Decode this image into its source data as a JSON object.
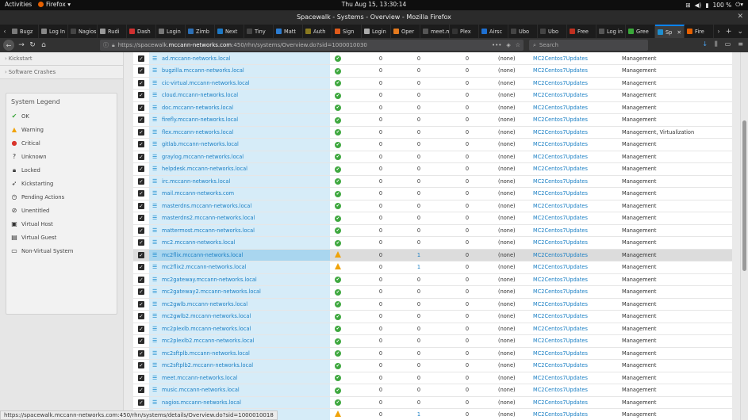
{
  "topbar": {
    "activities": "Activities",
    "app": "Firefox ▾",
    "clock": "Thu Aug 15, 13:30:14",
    "battery": "100 %"
  },
  "window": {
    "title": "Spacewalk - Systems - Overview - Mozilla Firefox"
  },
  "tabs": [
    {
      "label": "Bugz",
      "color": "#7a7a7a"
    },
    {
      "label": "Log In",
      "color": "#888888"
    },
    {
      "label": "Nagios",
      "color": "#444444"
    },
    {
      "label": "Rudi",
      "color": "#999999"
    },
    {
      "label": "Dash",
      "color": "#d03030"
    },
    {
      "label": "Login",
      "color": "#777777"
    },
    {
      "label": "Zimb",
      "color": "#2c6fb5"
    },
    {
      "label": "Next",
      "color": "#1d78c4"
    },
    {
      "label": "Tiny",
      "color": "#444444"
    },
    {
      "label": "Matt",
      "color": "#2c7cd1"
    },
    {
      "label": "Auth",
      "color": "#8a7a20"
    },
    {
      "label": "Sign",
      "color": "#e05a1a"
    },
    {
      "label": "Login",
      "color": "#aaaaaa"
    },
    {
      "label": "Oper",
      "color": "#e57a1e"
    },
    {
      "label": "meet.m",
      "color": "#555555"
    },
    {
      "label": "Plex",
      "color": "#333333"
    },
    {
      "label": "Airsc",
      "color": "#1e6fd0"
    },
    {
      "label": "Ubo",
      "color": "#444444"
    },
    {
      "label": "Ubo",
      "color": "#444444"
    },
    {
      "label": "Free",
      "color": "#c03020"
    },
    {
      "label": "Log in",
      "color": "#555555"
    },
    {
      "label": "Gree",
      "color": "#3aa83a"
    },
    {
      "label": "Sp",
      "color": "#1e8fd0"
    },
    {
      "label": "Fire",
      "color": "#e66000"
    }
  ],
  "url": {
    "prefix": "https://spacewalk.",
    "host": "mccann-networks.com",
    "rest": ":450/rhn/systems/Overview.do?sid=1000010030"
  },
  "search": {
    "placeholder": "Search"
  },
  "sidebar": {
    "links": [
      "Kickstart",
      "Software Crashes"
    ],
    "legend_title": "System Legend",
    "legend": [
      {
        "label": "OK",
        "icon": "ok-icon"
      },
      {
        "label": "Warning",
        "icon": "warning-icon"
      },
      {
        "label": "Critical",
        "icon": "critical-icon"
      },
      {
        "label": "Unknown",
        "icon": "unknown-icon"
      },
      {
        "label": "Locked",
        "icon": "lock-icon"
      },
      {
        "label": "Kickstarting",
        "icon": "rocket-icon"
      },
      {
        "label": "Pending Actions",
        "icon": "clock-icon"
      },
      {
        "label": "Unentitled",
        "icon": "unentitled-icon"
      },
      {
        "label": "Virtual Host",
        "icon": "virtual-host-icon"
      },
      {
        "label": "Virtual Guest",
        "icon": "virtual-guest-icon"
      },
      {
        "label": "Non-Virtual System",
        "icon": "monitor-icon"
      }
    ]
  },
  "systems": [
    {
      "name": "ad.mccann-networks.local",
      "status": "ok",
      "u1": "0",
      "u2": "0",
      "u3": "0",
      "lock": "(none)",
      "channel": "MC2Centos7Updates",
      "entitlement": "Management"
    },
    {
      "name": "bugzilla.mccann-networks.local",
      "status": "ok",
      "u1": "0",
      "u2": "0",
      "u3": "0",
      "lock": "(none)",
      "channel": "MC2Centos7Updates",
      "entitlement": "Management"
    },
    {
      "name": "cic-virtual.mccann-networks.local",
      "status": "ok",
      "u1": "0",
      "u2": "0",
      "u3": "0",
      "lock": "(none)",
      "channel": "MC2Centos7Updates",
      "entitlement": "Management"
    },
    {
      "name": "cloud.mccann-networks.local",
      "status": "ok",
      "u1": "0",
      "u2": "0",
      "u3": "0",
      "lock": "(none)",
      "channel": "MC2Centos7Updates",
      "entitlement": "Management"
    },
    {
      "name": "doc.mccann-networks.local",
      "status": "ok",
      "u1": "0",
      "u2": "0",
      "u3": "0",
      "lock": "(none)",
      "channel": "MC2Centos7Updates",
      "entitlement": "Management"
    },
    {
      "name": "firefly.mccann-networks.local",
      "status": "ok",
      "u1": "0",
      "u2": "0",
      "u3": "0",
      "lock": "(none)",
      "channel": "MC2Centos7Updates",
      "entitlement": "Management"
    },
    {
      "name": "flex.mccann-networks.local",
      "status": "ok",
      "u1": "0",
      "u2": "0",
      "u3": "0",
      "lock": "(none)",
      "channel": "MC2Centos7Updates",
      "entitlement": "Management, Virtualization"
    },
    {
      "name": "gitlab.mccann-networks.local",
      "status": "ok",
      "u1": "0",
      "u2": "0",
      "u3": "0",
      "lock": "(none)",
      "channel": "MC2Centos7Updates",
      "entitlement": "Management"
    },
    {
      "name": "graylog.mccann-networks.local",
      "status": "ok",
      "u1": "0",
      "u2": "0",
      "u3": "0",
      "lock": "(none)",
      "channel": "MC2Centos7Updates",
      "entitlement": "Management"
    },
    {
      "name": "helpdesk.mccann-networks.local",
      "status": "ok",
      "u1": "0",
      "u2": "0",
      "u3": "0",
      "lock": "(none)",
      "channel": "MC2Centos7Updates",
      "entitlement": "Management"
    },
    {
      "name": "irc.mccann-networks.local",
      "status": "ok",
      "u1": "0",
      "u2": "0",
      "u3": "0",
      "lock": "(none)",
      "channel": "MC2Centos7Updates",
      "entitlement": "Management"
    },
    {
      "name": "mail.mccann-networks.com",
      "status": "ok",
      "u1": "0",
      "u2": "0",
      "u3": "0",
      "lock": "(none)",
      "channel": "MC2Centos7Updates",
      "entitlement": "Management"
    },
    {
      "name": "masterdns.mccann-networks.local",
      "status": "ok",
      "u1": "0",
      "u2": "0",
      "u3": "0",
      "lock": "(none)",
      "channel": "MC2Centos7Updates",
      "entitlement": "Management"
    },
    {
      "name": "masterdns2.mccann-networks.local",
      "status": "ok",
      "u1": "0",
      "u2": "0",
      "u3": "0",
      "lock": "(none)",
      "channel": "MC2Centos7Updates",
      "entitlement": "Management"
    },
    {
      "name": "mattermost.mccann-networks.local",
      "status": "ok",
      "u1": "0",
      "u2": "0",
      "u3": "0",
      "lock": "(none)",
      "channel": "MC2Centos7Updates",
      "entitlement": "Management"
    },
    {
      "name": "mc2.mccann-networks.local",
      "status": "ok",
      "u1": "0",
      "u2": "0",
      "u3": "0",
      "lock": "(none)",
      "channel": "MC2Centos7Updates",
      "entitlement": "Management"
    },
    {
      "name": "mc2flix.mccann-networks.local",
      "status": "warn",
      "u1": "0",
      "u2": "1",
      "u3": "0",
      "lock": "(none)",
      "channel": "MC2Centos7Updates",
      "entitlement": "Management",
      "highlight": true
    },
    {
      "name": "mc2flix2.mccann-networks.local",
      "status": "warn",
      "u1": "0",
      "u2": "1",
      "u3": "0",
      "lock": "(none)",
      "channel": "MC2Centos7Updates",
      "entitlement": "Management"
    },
    {
      "name": "mc2gateway.mccann-networks.local",
      "status": "ok",
      "u1": "0",
      "u2": "0",
      "u3": "0",
      "lock": "(none)",
      "channel": "MC2Centos7Updates",
      "entitlement": "Management"
    },
    {
      "name": "mc2gateway2.mccann-networks.local",
      "status": "ok",
      "u1": "0",
      "u2": "0",
      "u3": "0",
      "lock": "(none)",
      "channel": "MC2Centos7Updates",
      "entitlement": "Management"
    },
    {
      "name": "mc2gwlb.mccann-networks.local",
      "status": "ok",
      "u1": "0",
      "u2": "0",
      "u3": "0",
      "lock": "(none)",
      "channel": "MC2Centos7Updates",
      "entitlement": "Management"
    },
    {
      "name": "mc2gwlb2.mccann-networks.local",
      "status": "ok",
      "u1": "0",
      "u2": "0",
      "u3": "0",
      "lock": "(none)",
      "channel": "MC2Centos7Updates",
      "entitlement": "Management"
    },
    {
      "name": "mc2plexlb.mccann-networks.local",
      "status": "ok",
      "u1": "0",
      "u2": "0",
      "u3": "0",
      "lock": "(none)",
      "channel": "MC2Centos7Updates",
      "entitlement": "Management"
    },
    {
      "name": "mc2plexlb2.mccann-networks.local",
      "status": "ok",
      "u1": "0",
      "u2": "0",
      "u3": "0",
      "lock": "(none)",
      "channel": "MC2Centos7Updates",
      "entitlement": "Management"
    },
    {
      "name": "mc2sftplb.mccann-networks.local",
      "status": "ok",
      "u1": "0",
      "u2": "0",
      "u3": "0",
      "lock": "(none)",
      "channel": "MC2Centos7Updates",
      "entitlement": "Management"
    },
    {
      "name": "mc2sftplb2.mccann-networks.local",
      "status": "ok",
      "u1": "0",
      "u2": "0",
      "u3": "0",
      "lock": "(none)",
      "channel": "MC2Centos7Updates",
      "entitlement": "Management"
    },
    {
      "name": "meet.mccann-networks.local",
      "status": "ok",
      "u1": "0",
      "u2": "0",
      "u3": "0",
      "lock": "(none)",
      "channel": "MC2Centos7Updates",
      "entitlement": "Management"
    },
    {
      "name": "music.mccann-networks.local",
      "status": "ok",
      "u1": "0",
      "u2": "0",
      "u3": "0",
      "lock": "(none)",
      "channel": "MC2Centos7Updates",
      "entitlement": "Management"
    },
    {
      "name": "nagios.mccann-networks.local",
      "status": "ok",
      "u1": "0",
      "u2": "0",
      "u3": "0",
      "lock": "(none)",
      "channel": "MC2Centos7Updates",
      "entitlement": "Management"
    },
    {
      "name": "",
      "status": "warn",
      "u1": "0",
      "u2": "1",
      "u3": "0",
      "lock": "(none)",
      "channel": "MC2Centos7Updates",
      "entitlement": "Management"
    }
  ],
  "status_bar": {
    "url": "https://spacewalk.mccann-networks.com:450/rhn/systems/details/Overview.do?sid=1000010018"
  }
}
